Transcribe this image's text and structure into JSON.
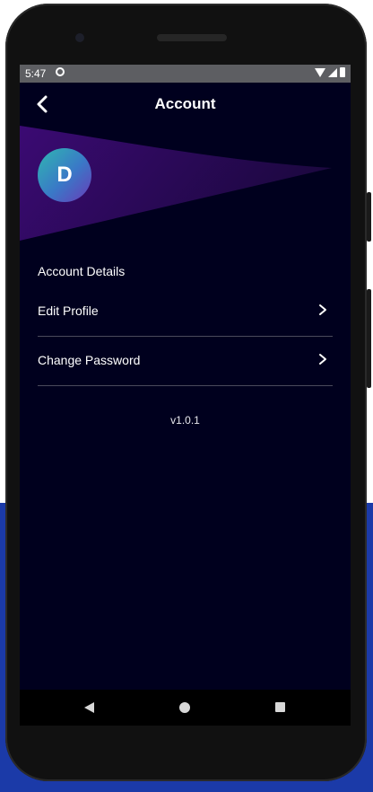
{
  "status_bar": {
    "time": "5:47",
    "icons": [
      "sync-icon",
      "wifi-icon",
      "signal-icon",
      "battery-icon"
    ]
  },
  "app_bar": {
    "title": "Account",
    "back_icon": "chevron-left-icon"
  },
  "profile": {
    "avatar_initial": "D"
  },
  "account": {
    "section_title": "Account Details",
    "items": [
      {
        "label": "Edit Profile",
        "icon": "chevron-right-icon"
      },
      {
        "label": "Change Password",
        "icon": "chevron-right-icon"
      }
    ]
  },
  "footer": {
    "version": "v1.0.1"
  },
  "nav_bar": {
    "buttons": [
      "back-triangle-icon",
      "home-circle-icon",
      "recents-square-icon"
    ]
  },
  "colors": {
    "screen_background": "#00001e",
    "banner_gradient": [
      "#3b0a73",
      "#220a4e"
    ],
    "avatar_gradient": [
      "#2fb7b1",
      "#3a78c7",
      "#6a3bb8"
    ],
    "page_background_blue": "#1b3aa8"
  }
}
